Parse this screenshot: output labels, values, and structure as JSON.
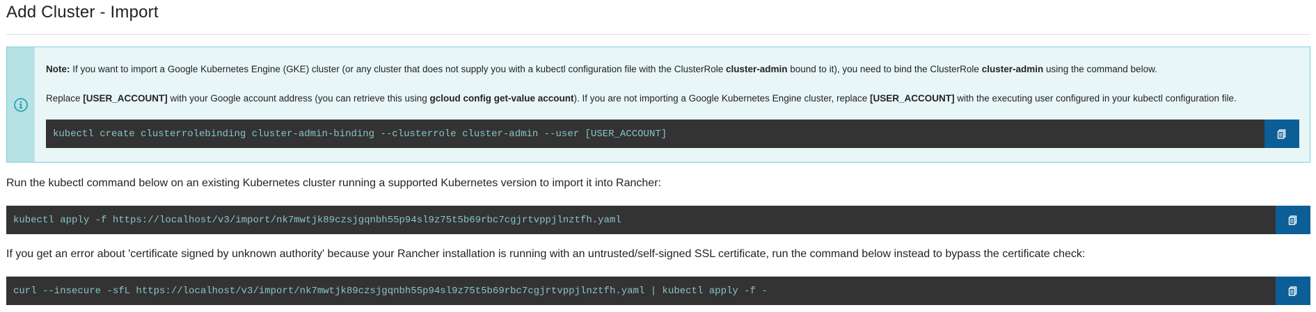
{
  "page": {
    "title": "Add Cluster - Import"
  },
  "note": {
    "icon": "info-circle-icon",
    "line1": {
      "label": "Note:",
      "text_a": " If you want to import a Google Kubernetes Engine (GKE) cluster (or any cluster that does not supply you with a kubectl configuration file with the ClusterRole ",
      "bold_a": "cluster-admin",
      "text_b": " bound to it), you need to bind the ClusterRole ",
      "bold_b": "cluster-admin",
      "text_c": " using the command below."
    },
    "line2": {
      "text_a": "Replace ",
      "bold_a": "[USER_ACCOUNT]",
      "text_b": " with your Google account address (you can retrieve this using ",
      "bold_b": "gcloud config get-value account",
      "text_c": "). If you are not importing a Google Kubernetes Engine cluster, replace ",
      "bold_c": "[USER_ACCOUNT]",
      "text_d": " with the executing user configured in your kubectl configuration file."
    },
    "command": "kubectl create clusterrolebinding cluster-admin-binding --clusterrole cluster-admin --user [USER_ACCOUNT]"
  },
  "instructions": {
    "import_text": "Run the kubectl command below on an existing Kubernetes cluster running a supported Kubernetes version to import it into Rancher:",
    "import_command": "kubectl apply -f https://localhost/v3/import/nk7mwtjk89czsjgqnbh55p94sl9z75t5b69rbc7cgjrtvppjlnztfh.yaml",
    "insecure_text": "If you get an error about 'certificate signed by unknown authority' because your Rancher installation is running with an untrusted/self-signed SSL certificate, run the command below instead to bypass the certificate check:",
    "insecure_command": "curl --insecure -sfL https://localhost/v3/import/nk7mwtjk89czsjgqnbh55p94sl9z75t5b69rbc7cgjrtvppjlnztfh.yaml | kubectl apply -f -"
  },
  "icons": {
    "copy": "copy-icon"
  },
  "colors": {
    "note_border": "#7ccfd6",
    "note_background": "#e9f6f7",
    "note_stripe": "#b6e2e6",
    "code_background": "#333333",
    "code_text": "#89c3c7",
    "copy_button": "#0c5f96"
  }
}
